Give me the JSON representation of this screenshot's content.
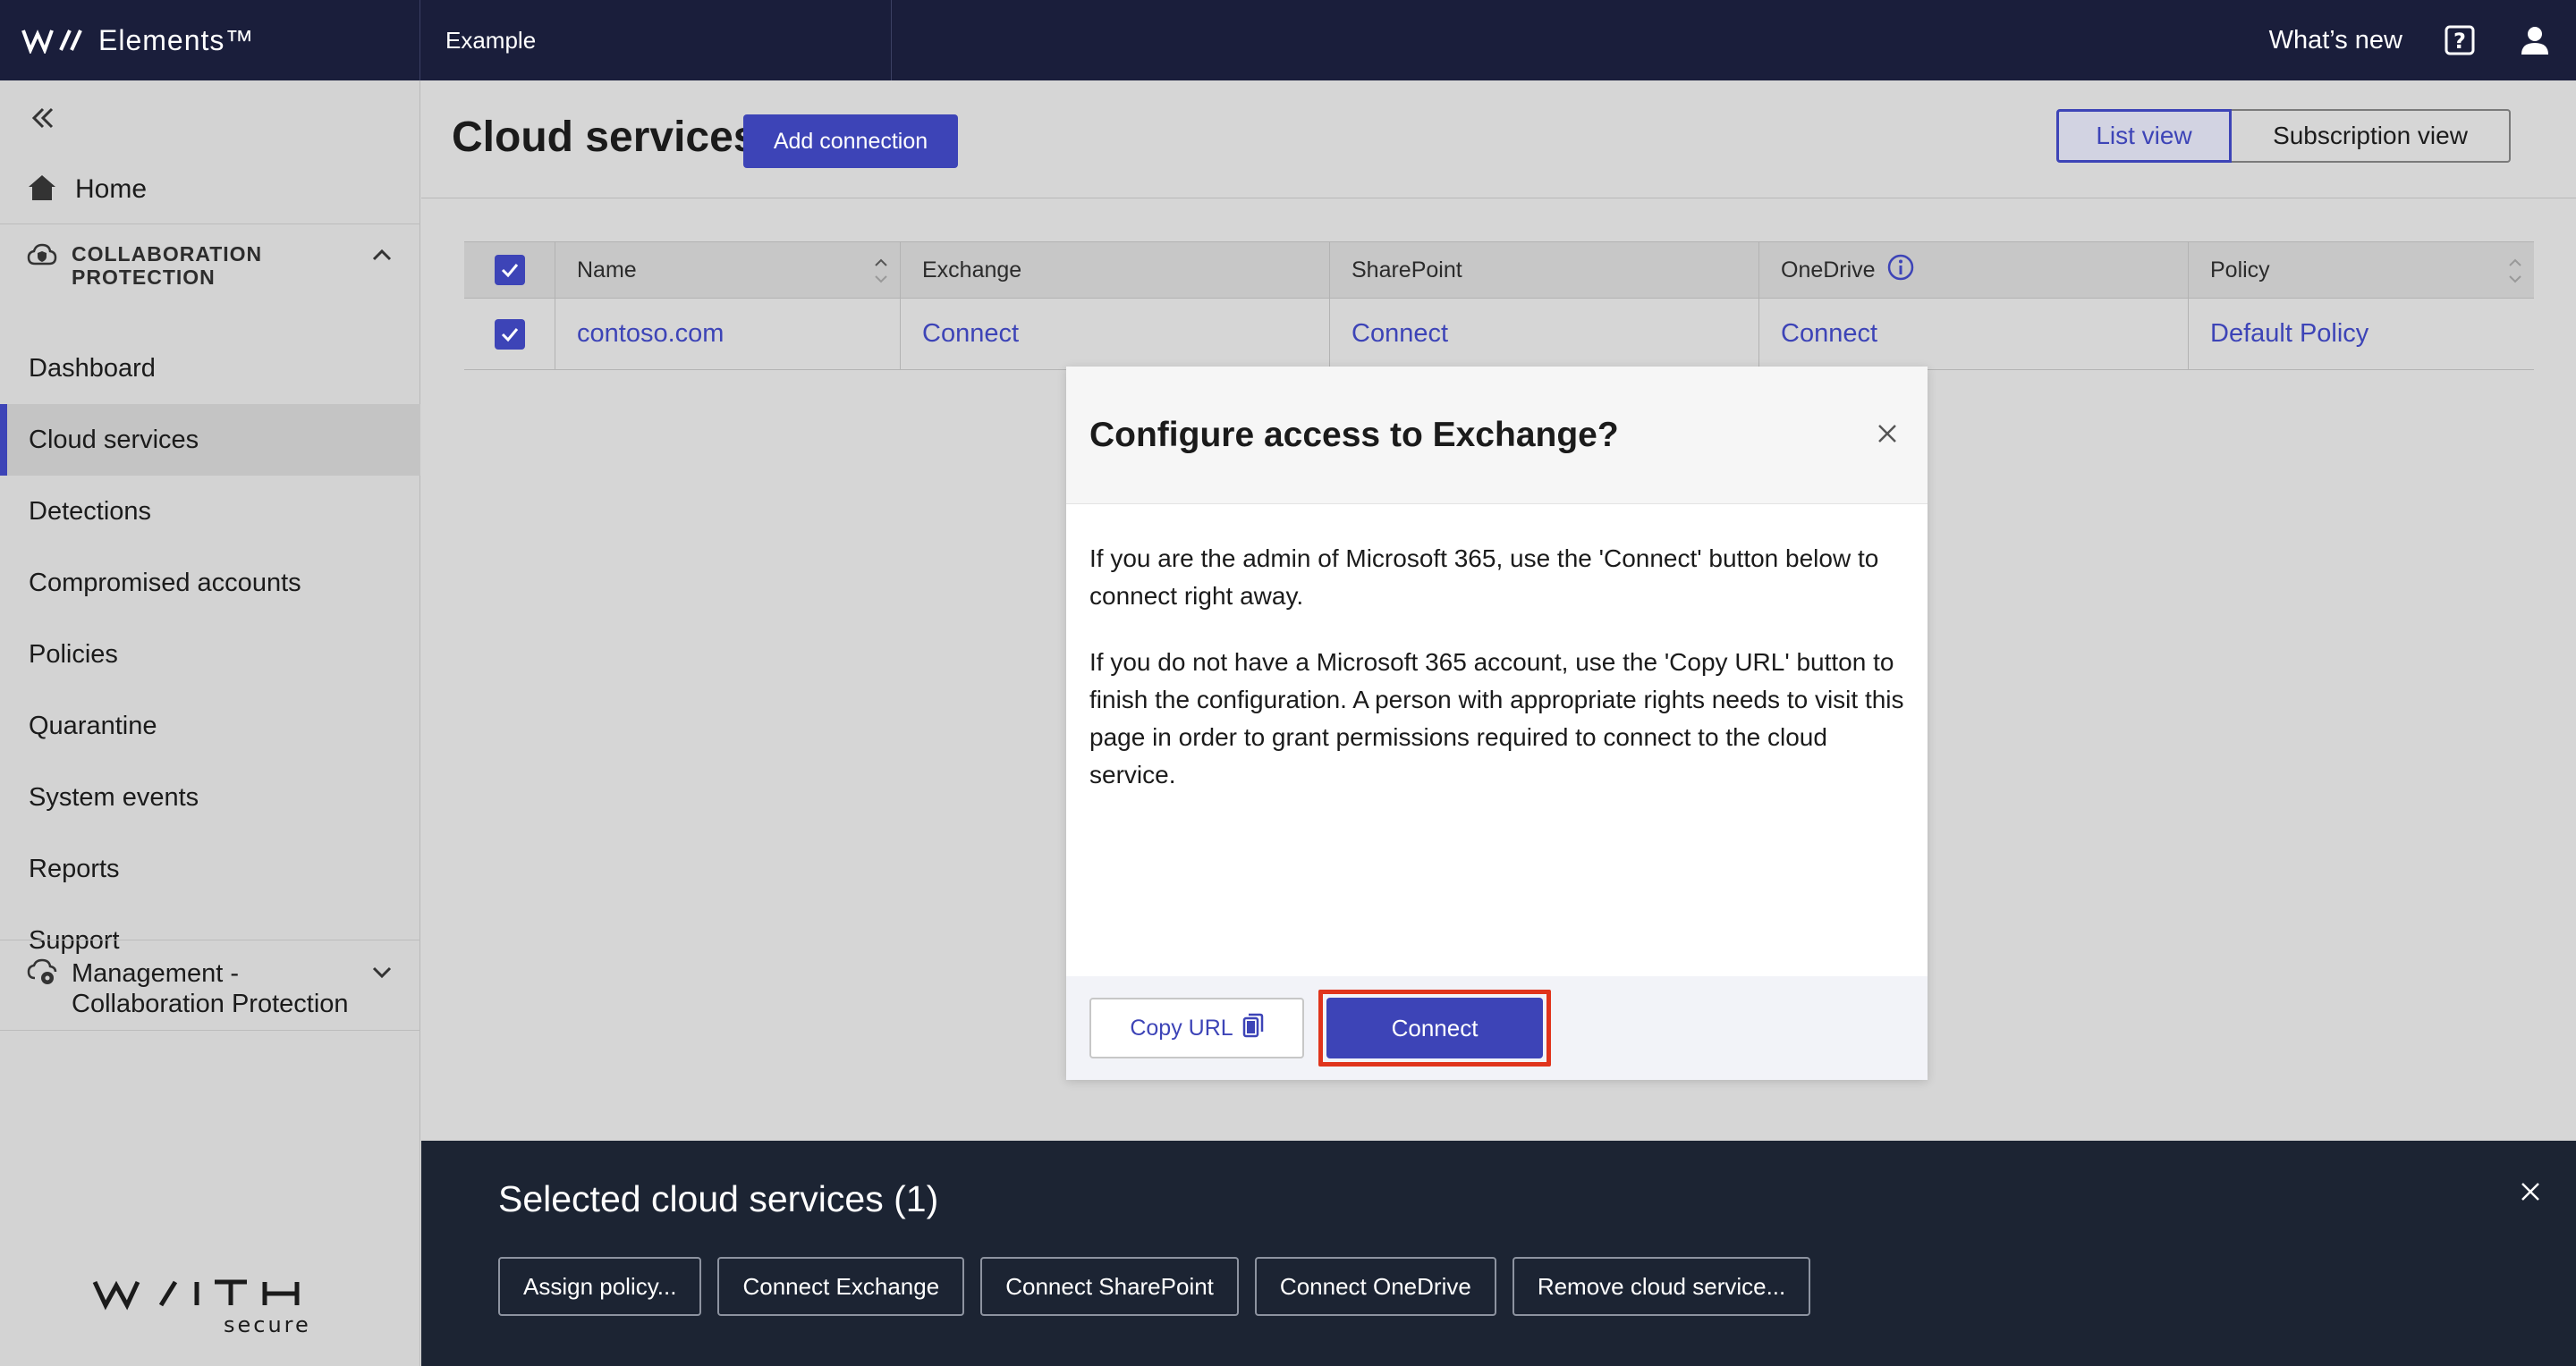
{
  "topbar": {
    "brand": "Elements™",
    "org": "Example",
    "whats_new": "What’s new"
  },
  "sidebar": {
    "home": "Home",
    "section_title_line1": "COLLABORATION",
    "section_title_line2": "PROTECTION",
    "items": [
      {
        "label": "Dashboard"
      },
      {
        "label": "Cloud services",
        "active": true
      },
      {
        "label": "Detections"
      },
      {
        "label": "Compromised accounts"
      },
      {
        "label": "Policies"
      },
      {
        "label": "Quarantine"
      },
      {
        "label": "System events"
      },
      {
        "label": "Reports"
      },
      {
        "label": "Support"
      }
    ],
    "management_line1": "Management -",
    "management_line2": "Collaboration Protection",
    "brand_bottom_top": "WITH",
    "brand_bottom_sub": "secure"
  },
  "page": {
    "title": "Cloud services",
    "add_connection": "Add connection",
    "view_list": "List view",
    "view_subscription": "Subscription view"
  },
  "table": {
    "headers": {
      "name": "Name",
      "exchange": "Exchange",
      "sharepoint": "SharePoint",
      "onedrive": "OneDrive",
      "policy": "Policy"
    },
    "rows": [
      {
        "name": "contoso.com",
        "exchange": "Connect",
        "sharepoint": "Connect",
        "onedrive": "Connect",
        "policy": "Default Policy",
        "checked": true
      }
    ]
  },
  "modal": {
    "title": "Configure access to Exchange?",
    "paragraph1": "If you are the admin of Microsoft 365, use the 'Connect' button below to connect right away.",
    "paragraph2": "If you do not have a Microsoft 365 account, use the 'Copy URL' button to finish the configuration. A person with appropriate rights needs to visit this page in order to grant permissions required to connect to the cloud service.",
    "copy_url": "Copy URL",
    "connect": "Connect"
  },
  "action_bar": {
    "title": "Selected cloud services (1)",
    "buttons": [
      "Assign policy...",
      "Connect Exchange",
      "Connect SharePoint",
      "Connect OneDrive",
      "Remove cloud service..."
    ]
  },
  "colors": {
    "accent": "#3d44b7",
    "topbar": "#1a1e3b",
    "action_bar": "#1c2433",
    "highlight": "#e0341c"
  }
}
